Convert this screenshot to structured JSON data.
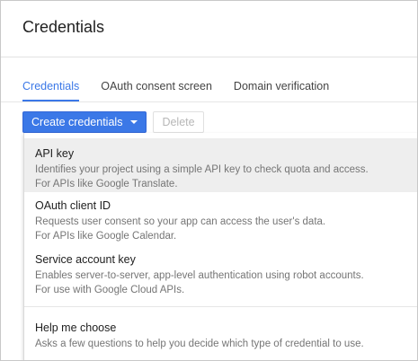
{
  "header": {
    "title": "Credentials"
  },
  "tabs": [
    {
      "label": "Credentials",
      "active": true
    },
    {
      "label": "OAuth consent screen",
      "active": false
    },
    {
      "label": "Domain verification",
      "active": false
    }
  ],
  "toolbar": {
    "create_label": "Create credentials",
    "delete_label": "Delete"
  },
  "menu": {
    "items": [
      {
        "title": "API key",
        "desc1": "Identifies your project using a simple API key to check quota and access.",
        "desc2": "For APIs like Google Translate."
      },
      {
        "title": "OAuth client ID",
        "desc1": "Requests user consent so your app can access the user's data.",
        "desc2": "For APIs like Google Calendar."
      },
      {
        "title": "Service account key",
        "desc1": "Enables server-to-server, app-level authentication using robot accounts.",
        "desc2": "For use with Google Cloud APIs."
      },
      {
        "title": "Help me choose",
        "desc1": "Asks a few questions to help you decide which type of credential to use."
      }
    ]
  },
  "colors": {
    "accent": "#3b78e7",
    "text_primary": "#212121",
    "text_secondary": "#757575",
    "highlight": "#eeeeee"
  }
}
